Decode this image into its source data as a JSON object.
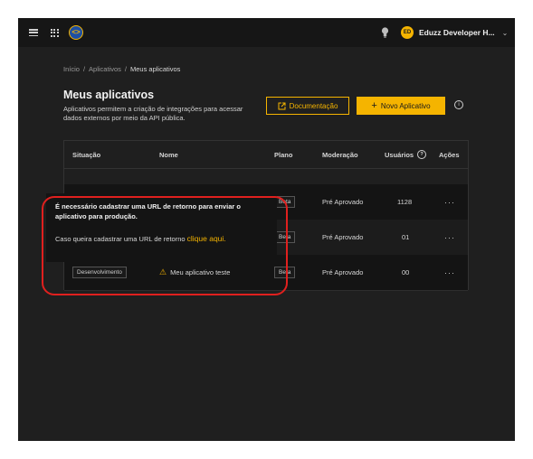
{
  "topbar": {
    "menu_icon": "hamburger-icon",
    "apps_icon": "grid-icon",
    "logo_icon": "eduzz-logo-icon",
    "logo_text": "<>",
    "bulb_icon": "lightbulb-icon",
    "user_initials": "ED",
    "user_name": "Eduzz Developer H...",
    "chevron": "⌄"
  },
  "breadcrumb": {
    "items": [
      "Início",
      "Aplicativos",
      "Meus aplicativos"
    ],
    "separator": "/"
  },
  "page": {
    "title": "Meus aplicativos",
    "subtitle": "Aplicativos permitem a criação de integrações para acessar dados externos por meio da API pública."
  },
  "buttons": {
    "doc_label": "Documentação",
    "new_label": "Novo Aplicativo",
    "new_icon": "+",
    "info": "i"
  },
  "table": {
    "headers": [
      "Situação",
      "Nome",
      "Plano",
      "Moderação",
      "Usuários",
      "Ações"
    ],
    "rows": [
      {
        "situacao": "",
        "nome": "",
        "plano": "Beta",
        "moderacao": "Pré Aprovado",
        "usuarios": "1128",
        "acoes": "···"
      },
      {
        "situacao": "",
        "nome": "",
        "plano": "Beta",
        "moderacao": "Pré Aprovado",
        "usuarios": "01",
        "acoes": "···"
      },
      {
        "situacao": "Desenvolvimento",
        "nome": "Meu aplicativo teste",
        "plano": "Beta",
        "moderacao": "Pré Aprovado",
        "usuarios": "00",
        "acoes": "···"
      }
    ]
  },
  "tooltip": {
    "message": "É necessário cadastrar uma URL de retorno para enviar o aplicativo para produção.",
    "cta_text": "Caso queira cadastrar uma URL de retorno",
    "cta_link": "clique aqui."
  },
  "colors": {
    "accent": "#f5b400",
    "background": "#1f1f1f",
    "highlight": "#e0201e"
  }
}
